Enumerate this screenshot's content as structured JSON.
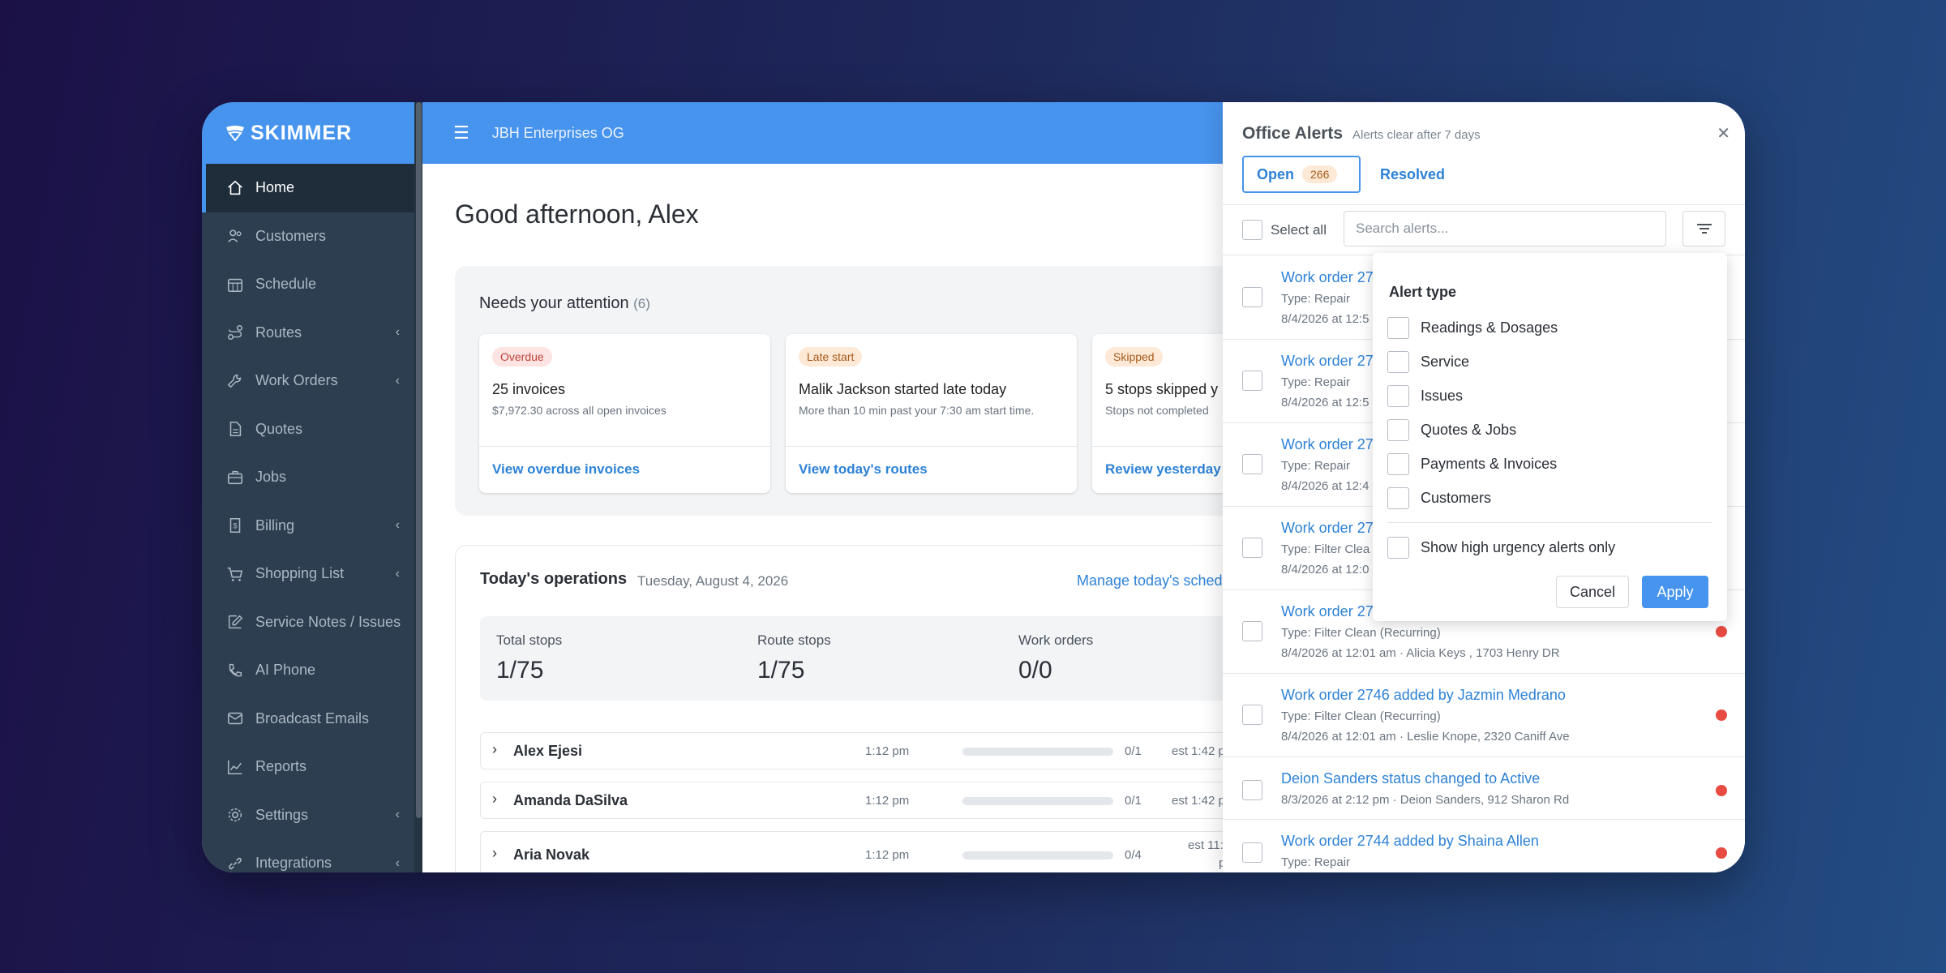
{
  "app": {
    "brand": "SKIMMER",
    "company": "JBH Enterprises OG"
  },
  "sidebar": {
    "items": [
      {
        "label": "Home",
        "icon": "home-icon",
        "active": true,
        "expandable": false
      },
      {
        "label": "Customers",
        "icon": "users-icon",
        "active": false,
        "expandable": false
      },
      {
        "label": "Schedule",
        "icon": "calendar-icon",
        "active": false,
        "expandable": false
      },
      {
        "label": "Routes",
        "icon": "route-icon",
        "active": false,
        "expandable": true
      },
      {
        "label": "Work Orders",
        "icon": "wrench-icon",
        "active": false,
        "expandable": true
      },
      {
        "label": "Quotes",
        "icon": "document-icon",
        "active": false,
        "expandable": false
      },
      {
        "label": "Jobs",
        "icon": "briefcase-icon",
        "active": false,
        "expandable": false
      },
      {
        "label": "Billing",
        "icon": "billing-icon",
        "active": false,
        "expandable": true
      },
      {
        "label": "Shopping List",
        "icon": "cart-icon",
        "active": false,
        "expandable": true
      },
      {
        "label": "Service Notes / Issues",
        "icon": "edit-icon",
        "active": false,
        "expandable": false
      },
      {
        "label": "AI Phone",
        "icon": "phone-ai-icon",
        "active": false,
        "expandable": false
      },
      {
        "label": "Broadcast Emails",
        "icon": "mail-icon",
        "active": false,
        "expandable": false
      },
      {
        "label": "Reports",
        "icon": "chart-icon",
        "active": false,
        "expandable": false
      },
      {
        "label": "Settings",
        "icon": "gear-icon",
        "active": false,
        "expandable": true
      },
      {
        "label": "Integrations",
        "icon": "link-icon",
        "active": false,
        "expandable": true
      }
    ]
  },
  "main": {
    "greeting": "Good afternoon, Alex",
    "attention": {
      "title": "Needs your attention",
      "count": "(6)",
      "cards": [
        {
          "badge": "Overdue",
          "title": "25 invoices",
          "subtitle": "$7,972.30 across all open invoices",
          "link": "View overdue invoices"
        },
        {
          "badge": "Late start",
          "title": "Malik Jackson started late today",
          "subtitle": "More than 10 min past your 7:30 am start time.",
          "link": "View today's routes"
        },
        {
          "badge": "Skipped",
          "title": "5 stops skipped y",
          "subtitle": "Stops not completed",
          "link": "Review yesterday"
        }
      ]
    },
    "operations": {
      "title": "Today's operations",
      "date": "Tuesday, August 4, 2026",
      "manage_link": "Manage today's sched",
      "stats": [
        {
          "label": "Total stops",
          "value": "1/75"
        },
        {
          "label": "Route stops",
          "value": "1/75"
        },
        {
          "label": "Work orders",
          "value": "0/0"
        }
      ],
      "rows": [
        {
          "name": "Alex Ejesi",
          "time": "1:12 pm",
          "count": "0/1",
          "est": "est 1:42 p",
          "progress": 0
        },
        {
          "name": "Amanda DaSilva",
          "time": "1:12 pm",
          "count": "0/1",
          "est": "est 1:42 p",
          "progress": 0
        },
        {
          "name": "Aria Novak",
          "time": "1:12 pm",
          "count": "0/4",
          "est": "est 11:",
          "est2": "p",
          "progress": 0
        }
      ]
    }
  },
  "alerts": {
    "title": "Office Alerts",
    "subtitle": "Alerts clear after 7 days",
    "tab_open": "Open",
    "open_count": "266",
    "tab_resolved": "Resolved",
    "select_all": "Select all",
    "search_placeholder": "Search alerts...",
    "items": [
      {
        "title": "Work order 27",
        "line2": "Type: Repair",
        "line3": "8/4/2026 at 12:5",
        "urgent": false
      },
      {
        "title": "Work order 27",
        "line2": "Type: Repair",
        "line3": "8/4/2026 at 12:5",
        "urgent": false
      },
      {
        "title": "Work order 27",
        "line2": "Type: Repair",
        "line3": "8/4/2026 at 12:4",
        "urgent": false
      },
      {
        "title": "Work order 27",
        "line2": "Type: Filter Clea",
        "line3": "8/4/2026 at 12:0",
        "urgent": false
      },
      {
        "title": "Work order 27",
        "line2": "Type: Filter Clean (Recurring)",
        "line3": "8/4/2026 at 12:01 am · Alicia Keys , 1703 Henry DR",
        "urgent": true
      },
      {
        "title": "Work order 2746 added by Jazmin Medrano",
        "line2": "Type: Filter Clean (Recurring)",
        "line3": "8/4/2026 at 12:01 am · Leslie Knope, 2320 Caniff Ave",
        "urgent": true
      },
      {
        "title": "Deion Sanders status changed to Active",
        "line2": "8/3/2026 at 2:12 pm · Deion Sanders, 912 Sharon Rd",
        "line3": "",
        "urgent": true
      },
      {
        "title": "Work order 2744 added by Shaina Allen",
        "line2": "Type: Repair",
        "line3": "",
        "urgent": true
      }
    ],
    "filter": {
      "title": "Alert type",
      "options": [
        "Readings & Dosages",
        "Service",
        "Issues",
        "Quotes & Jobs",
        "Payments & Invoices",
        "Customers"
      ],
      "urgency_label": "Show high urgency alerts only",
      "cancel": "Cancel",
      "apply": "Apply"
    }
  },
  "colors": {
    "accent": "#4794ee",
    "sidebar": "#2d3e50",
    "link": "#2d82d6",
    "danger": "#e84b42"
  }
}
